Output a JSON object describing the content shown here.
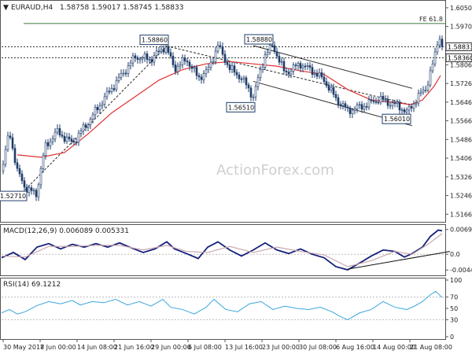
{
  "header": {
    "symbol_label": "EURAUD,H4",
    "ohlc_text": "1.58758 1.59017 1.58745 1.58833"
  },
  "watermark": "ActionForex.com",
  "colors": {
    "background": "#ffffff",
    "candles": "#1f3d6b",
    "ema": "#e03030",
    "macd_line": "#15207a",
    "macd_signal": "#c9a8b0",
    "rsi": "#3aa6dc",
    "grid_dotted": "#9a9a9a",
    "annotation_line": "#2a2a2a",
    "label_box_border": "#1f3d6b"
  },
  "chart_data": [
    {
      "type": "candlestick",
      "title": "EURAUD,H4",
      "ylim": [
        1.514,
        1.607
      ],
      "y_ticks": [
        "1.60500",
        "1.59700",
        "1.58900",
        "1.58060",
        "1.57260",
        "1.56460",
        "1.55660",
        "1.54860",
        "1.54060",
        "1.53260",
        "1.52460",
        "1.51660"
      ],
      "y_tick_values": [
        1.605,
        1.597,
        1.589,
        1.5806,
        1.5726,
        1.5646,
        1.5566,
        1.5486,
        1.5406,
        1.5326,
        1.5246,
        1.5166
      ],
      "x_tick_labels": [
        "30 May 2018",
        "7 Jun 00:00",
        "14 Jun 08:00",
        "21 Jun 16:00",
        "29 Jun 00:00",
        "6 Jul 08:00",
        "13 Jul 16:00",
        "23 Jul 00:00",
        "30 Jul 08:00",
        "6 Aug 16:00",
        "14 Aug 00:00",
        "21 Aug 08:00"
      ],
      "close_path": [
        [
          0,
          1.535
        ],
        [
          10,
          1.552
        ],
        [
          20,
          1.535
        ],
        [
          30,
          1.528
        ],
        [
          44,
          1.525
        ],
        [
          55,
          1.545
        ],
        [
          70,
          1.552
        ],
        [
          90,
          1.547
        ],
        [
          110,
          1.556
        ],
        [
          130,
          1.566
        ],
        [
          150,
          1.575
        ],
        [
          170,
          1.584
        ],
        [
          190,
          1.583
        ],
        [
          208,
          1.5886
        ],
        [
          220,
          1.579
        ],
        [
          235,
          1.583
        ],
        [
          250,
          1.575
        ],
        [
          262,
          1.578
        ],
        [
          275,
          1.5888
        ],
        [
          290,
          1.579
        ],
        [
          305,
          1.575
        ],
        [
          320,
          1.567
        ],
        [
          335,
          1.585
        ],
        [
          345,
          1.5888
        ],
        [
          360,
          1.577
        ],
        [
          380,
          1.581
        ],
        [
          395,
          1.578
        ],
        [
          410,
          1.574
        ],
        [
          425,
          1.566
        ],
        [
          440,
          1.561
        ],
        [
          460,
          1.563
        ],
        [
          480,
          1.566
        ],
        [
          495,
          1.564
        ],
        [
          505,
          1.563
        ],
        [
          515,
          1.5601
        ],
        [
          530,
          1.567
        ],
        [
          540,
          1.571
        ],
        [
          550,
          1.583
        ],
        [
          556,
          1.594
        ],
        [
          560,
          1.5883
        ]
      ],
      "ema_path": [
        [
          20,
          1.542
        ],
        [
          50,
          1.541
        ],
        [
          80,
          1.543
        ],
        [
          110,
          1.551
        ],
        [
          140,
          1.56
        ],
        [
          170,
          1.567
        ],
        [
          200,
          1.574
        ],
        [
          230,
          1.5785
        ],
        [
          260,
          1.581
        ],
        [
          290,
          1.582
        ],
        [
          320,
          1.581
        ],
        [
          350,
          1.58
        ],
        [
          380,
          1.578
        ],
        [
          410,
          1.5765
        ],
        [
          440,
          1.57
        ],
        [
          470,
          1.5655
        ],
        [
          500,
          1.5645
        ],
        [
          520,
          1.5635
        ],
        [
          535,
          1.5655
        ],
        [
          550,
          1.5715
        ],
        [
          558,
          1.576
        ]
      ],
      "horizontal_levels": [
        {
          "label": "FE 61.8",
          "value": 1.5983
        },
        {
          "label": "",
          "value": 1.5883
        },
        {
          "label": "",
          "value": 1.5836
        }
      ],
      "price_badges": [
        {
          "label": "1.58833",
          "value": 1.5883
        },
        {
          "label": "1.58360",
          "value": 1.5836
        }
      ],
      "annotations": [
        {
          "label": "1.58860",
          "x": 210,
          "value": 1.5886
        },
        {
          "label": "1.58880",
          "x": 343,
          "value": 1.5888
        },
        {
          "label": "1.56510",
          "x": 320,
          "value": 1.5651
        },
        {
          "label": "1.56010",
          "x": 518,
          "value": 1.5601
        },
        {
          "label": "1.52710",
          "x": 30,
          "value": 1.5271
        }
      ],
      "trend_lines": [
        {
          "from": [
            30,
            1.5271
          ],
          "to": [
            210,
            1.5886
          ]
        },
        {
          "from": [
            210,
            1.5886
          ],
          "to": [
            520,
            1.5635
          ]
        },
        {
          "from": [
            320,
            1.5888
          ],
          "to": [
            522,
            1.5705
          ]
        },
        {
          "from": [
            320,
            1.5735
          ],
          "to": [
            522,
            1.5545
          ]
        }
      ]
    },
    {
      "type": "line",
      "title": "MACD(12,26,9) 0.006089 0.005331",
      "ylim": [
        -0.0055,
        0.0078
      ],
      "y_ticks": [
        "0.006982",
        "0.0",
        "-0.00444"
      ],
      "y_tick_values": [
        0.006982,
        0.0,
        -0.00444
      ],
      "series": [
        {
          "name": "MACD",
          "path": [
            [
              0,
              -0.001
            ],
            [
              15,
              0.0005
            ],
            [
              30,
              -0.0015
            ],
            [
              45,
              0.002
            ],
            [
              60,
              0.003
            ],
            [
              75,
              0.0015
            ],
            [
              90,
              0.0028
            ],
            [
              105,
              0.002
            ],
            [
              120,
              0.003
            ],
            [
              135,
              0.002
            ],
            [
              150,
              0.0032
            ],
            [
              165,
              0.0018
            ],
            [
              180,
              0.0005
            ],
            [
              195,
              0.0015
            ],
            [
              210,
              0.0035
            ],
            [
              220,
              0.0015
            ],
            [
              235,
              0.0002
            ],
            [
              250,
              -0.0012
            ],
            [
              262,
              0.002
            ],
            [
              275,
              0.0035
            ],
            [
              290,
              0.0012
            ],
            [
              305,
              -0.0005
            ],
            [
              320,
              0.0012
            ],
            [
              335,
              0.0032
            ],
            [
              350,
              0.0012
            ],
            [
              365,
              0.0002
            ],
            [
              380,
              0.0015
            ],
            [
              395,
              0.0
            ],
            [
              410,
              -0.001
            ],
            [
              425,
              -0.0035
            ],
            [
              440,
              -0.0044
            ],
            [
              455,
              -0.0025
            ],
            [
              470,
              -0.0005
            ],
            [
              485,
              0.0012
            ],
            [
              500,
              0.0008
            ],
            [
              512,
              -0.0008
            ],
            [
              522,
              0.0002
            ],
            [
              535,
              0.002
            ],
            [
              545,
              0.005
            ],
            [
              555,
              0.0068
            ],
            [
              560,
              0.0066
            ]
          ]
        },
        {
          "name": "Signal",
          "path": [
            [
              0,
              -0.0005
            ],
            [
              30,
              -0.0008
            ],
            [
              60,
              0.0022
            ],
            [
              90,
              0.0022
            ],
            [
              120,
              0.0025
            ],
            [
              150,
              0.0025
            ],
            [
              180,
              0.0012
            ],
            [
              210,
              0.0025
            ],
            [
              235,
              0.0008
            ],
            [
              262,
              0.0005
            ],
            [
              290,
              0.0022
            ],
            [
              320,
              0.0005
            ],
            [
              350,
              0.002
            ],
            [
              380,
              0.0008
            ],
            [
              410,
              -0.0002
            ],
            [
              440,
              -0.0035
            ],
            [
              470,
              -0.0018
            ],
            [
              500,
              0.0008
            ],
            [
              522,
              0.0
            ],
            [
              540,
              0.0025
            ],
            [
              560,
              0.0058
            ]
          ]
        }
      ],
      "trend_lines": [
        {
          "from": [
            440,
            -0.0042
          ],
          "to": [
            570,
            0.0008
          ]
        }
      ]
    },
    {
      "type": "line",
      "title": "RSI(14) 69.1212",
      "ylim": [
        0,
        100
      ],
      "y_ticks": [
        "100",
        "70",
        "50",
        "30",
        "0"
      ],
      "y_tick_values": [
        100,
        70,
        50,
        30,
        0
      ],
      "series": [
        {
          "name": "RSI",
          "path": [
            [
              0,
              42
            ],
            [
              10,
              48
            ],
            [
              20,
              40
            ],
            [
              30,
              44
            ],
            [
              45,
              55
            ],
            [
              60,
              62
            ],
            [
              75,
              58
            ],
            [
              90,
              64
            ],
            [
              100,
              56
            ],
            [
              115,
              62
            ],
            [
              130,
              60
            ],
            [
              145,
              66
            ],
            [
              160,
              56
            ],
            [
              175,
              62
            ],
            [
              190,
              54
            ],
            [
              205,
              66
            ],
            [
              215,
              52
            ],
            [
              230,
              48
            ],
            [
              245,
              40
            ],
            [
              260,
              52
            ],
            [
              270,
              66
            ],
            [
              285,
              48
            ],
            [
              300,
              44
            ],
            [
              315,
              58
            ],
            [
              330,
              62
            ],
            [
              345,
              48
            ],
            [
              360,
              54
            ],
            [
              375,
              50
            ],
            [
              390,
              48
            ],
            [
              405,
              52
            ],
            [
              420,
              44
            ],
            [
              430,
              36
            ],
            [
              440,
              30
            ],
            [
              455,
              42
            ],
            [
              470,
              48
            ],
            [
              485,
              62
            ],
            [
              500,
              52
            ],
            [
              515,
              48
            ],
            [
              525,
              54
            ],
            [
              535,
              62
            ],
            [
              545,
              74
            ],
            [
              552,
              80
            ],
            [
              560,
              69
            ]
          ]
        }
      ]
    }
  ]
}
